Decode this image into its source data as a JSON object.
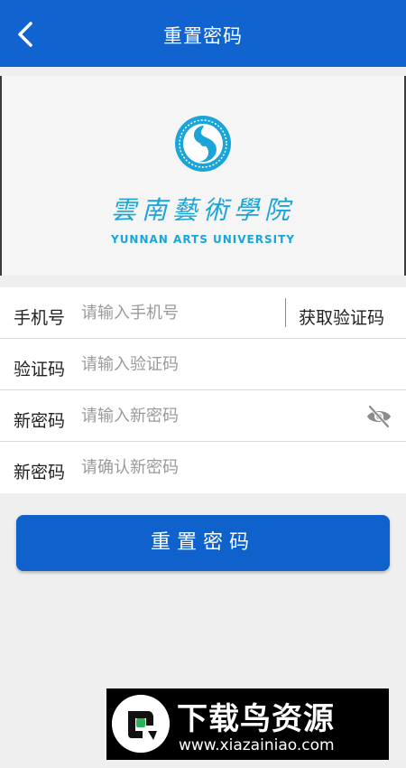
{
  "header": {
    "title": "重置密码",
    "back_icon": "chevron-left-icon"
  },
  "logo": {
    "emblem_icon": "yunnan-arts-university-emblem",
    "name_cn": "雲南藝術學院",
    "name_en": "YUNNAN ARTS UNIVERSITY",
    "color": "#1aa5d8"
  },
  "form": {
    "phone": {
      "label": "手机号",
      "placeholder": "请输入手机号",
      "value": ""
    },
    "get_code_label": "获取验证码",
    "code": {
      "label": "验证码",
      "placeholder": "请输入验证码",
      "value": ""
    },
    "new_password": {
      "label": "新密码",
      "placeholder": "请输入新密码",
      "value": "",
      "toggle_icon": "eye-off-icon"
    },
    "confirm_password": {
      "label": "新密码",
      "placeholder": "请确认新密码",
      "value": ""
    }
  },
  "submit_label": "重置密码",
  "watermark": {
    "title": "下载鸟资源",
    "url": "www.xiazainiao.com"
  },
  "colors": {
    "primary": "#1164cf",
    "background": "#efeff0",
    "accent_logo": "#1aa5d8"
  }
}
